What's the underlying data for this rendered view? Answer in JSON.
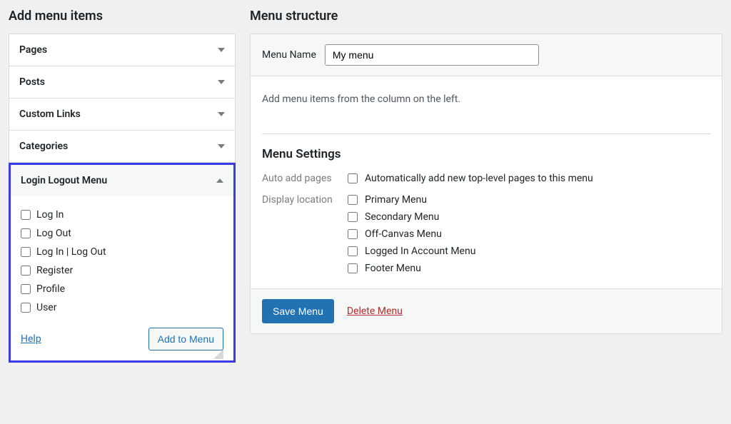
{
  "left": {
    "heading": "Add menu items",
    "panels": {
      "pages": "Pages",
      "posts": "Posts",
      "custom_links": "Custom Links",
      "categories": "Categories",
      "login_logout": {
        "title": "Login Logout Menu",
        "items": [
          "Log In",
          "Log Out",
          "Log In | Log Out",
          "Register",
          "Profile",
          "User"
        ],
        "help": "Help",
        "add_btn": "Add to Menu"
      }
    }
  },
  "right": {
    "heading": "Menu structure",
    "menu_name_label": "Menu Name",
    "menu_name_value": "My menu",
    "hint": "Add menu items from the column on the left.",
    "settings_heading": "Menu Settings",
    "auto_add": {
      "label": "Auto add pages",
      "option": "Automatically add new top-level pages to this menu"
    },
    "display": {
      "label": "Display location",
      "options": [
        "Primary Menu",
        "Secondary Menu",
        "Off-Canvas Menu",
        "Logged In Account Menu",
        "Footer Menu"
      ]
    },
    "save_btn": "Save Menu",
    "delete_link": "Delete Menu"
  }
}
